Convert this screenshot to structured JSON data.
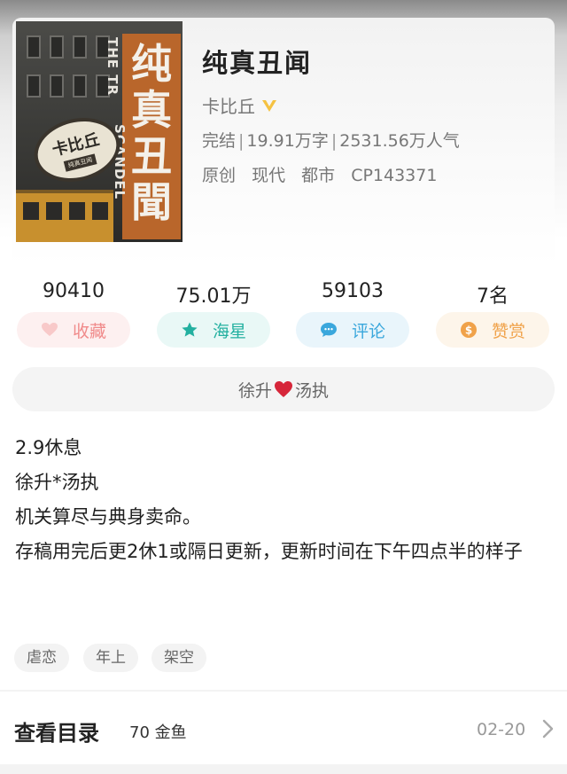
{
  "book": {
    "title": "纯真丑闻",
    "author": "卡比丘",
    "status": "完结",
    "word_count": "19.91万字",
    "popularity": "2531.56万人气",
    "tags_inline": [
      "原创",
      "现代",
      "都市",
      "CP143371"
    ]
  },
  "cover": {
    "title_chars": [
      "纯",
      "真",
      "丑",
      "聞"
    ],
    "english_left": "THE TR",
    "english_right": "SCANDEL",
    "stamp_author": "卡比丘",
    "stamp_tag": "纯真丑闻",
    "colors": {
      "banner": "#b9662b",
      "tram": "#c8902e"
    }
  },
  "stats": {
    "favorites": {
      "count": "90410",
      "label": "收藏",
      "icon": "heart-icon",
      "color": "#f08a8a"
    },
    "stars": {
      "count": "75.01万",
      "label": "海星",
      "icon": "star-icon",
      "color": "#23b0a0"
    },
    "comments": {
      "count": "59103",
      "label": "评论",
      "icon": "chat-bubble-icon",
      "color": "#3aa7dc"
    },
    "reward": {
      "count": "7名",
      "label": "赞赏",
      "icon": "coin-icon",
      "color": "#f0a24a"
    }
  },
  "cp": {
    "left": "徐升",
    "right": "汤执",
    "icon": "heart-icon"
  },
  "description": [
    "2.9休息",
    "徐升*汤执",
    "机关算尽与典身卖命。",
    "存稿用完后更2休1或隔日更新，更新时间在下午四点半的样子"
  ],
  "tags": [
    "虐恋",
    "年上",
    "架空"
  ],
  "catalog": {
    "label": "查看目录",
    "price": "70 金鱼",
    "date": "02-20",
    "icon": "chevron-right-icon"
  }
}
